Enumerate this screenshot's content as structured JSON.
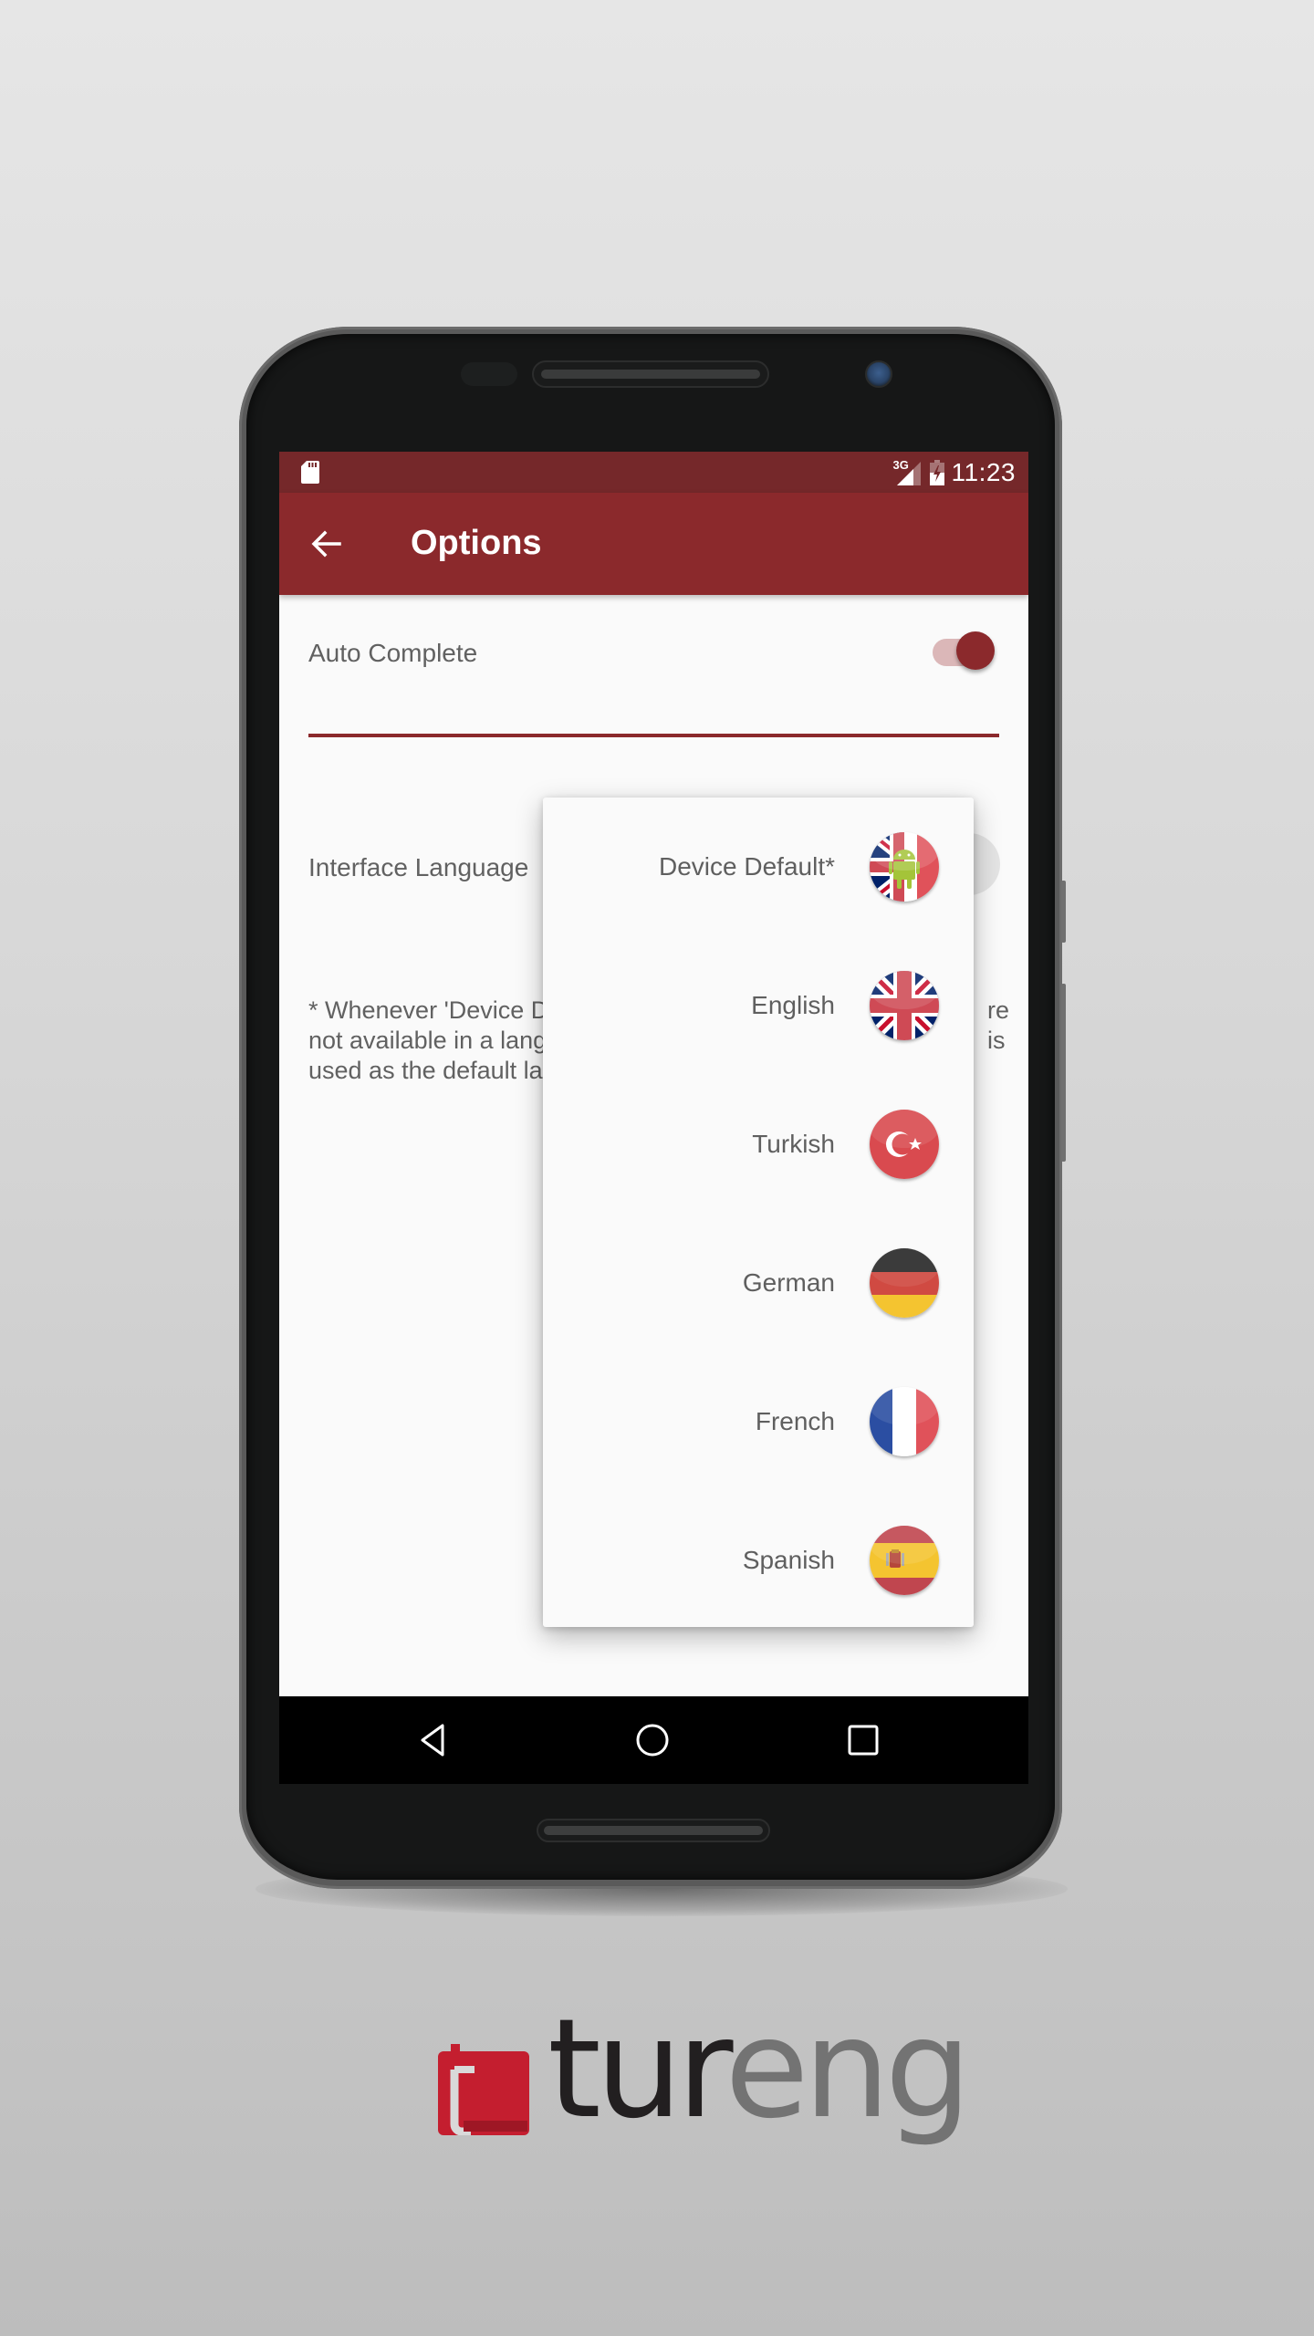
{
  "status_bar": {
    "network_label": "3G",
    "time": "11:23",
    "icons": [
      "sd-card-icon",
      "signal-3g-icon",
      "battery-charging-icon"
    ]
  },
  "app_bar": {
    "title": "Options",
    "back_icon": "arrow-back-icon"
  },
  "settings": {
    "auto_complete": {
      "label": "Auto Complete",
      "enabled": true
    },
    "interface_language": {
      "label": "Interface Language"
    },
    "note_visible_fragments": {
      "left_lines": "* Whenever 'Device D\nnot available in a lang\nused as the default la",
      "right_lines": "re\nis"
    }
  },
  "language_dropdown": {
    "items": [
      {
        "label": "Device Default*",
        "flag": "device-default-flag-icon"
      },
      {
        "label": "English",
        "flag": "uk-flag-icon"
      },
      {
        "label": "Turkish",
        "flag": "turkey-flag-icon"
      },
      {
        "label": "German",
        "flag": "germany-flag-icon"
      },
      {
        "label": "French",
        "flag": "france-flag-icon"
      },
      {
        "label": "Spanish",
        "flag": "spain-flag-icon"
      }
    ]
  },
  "nav_bar": {
    "buttons": [
      "back-triangle-icon",
      "home-circle-icon",
      "recents-square-icon"
    ]
  },
  "branding": {
    "logo_text_dark": "tur",
    "logo_text_grey": "eng"
  },
  "colors": {
    "primary": "#8b292c",
    "primary_dark": "#75282a",
    "toggle_track": "#dbb7b8",
    "text_secondary": "#616161",
    "logo_red": "#c41e2f"
  }
}
